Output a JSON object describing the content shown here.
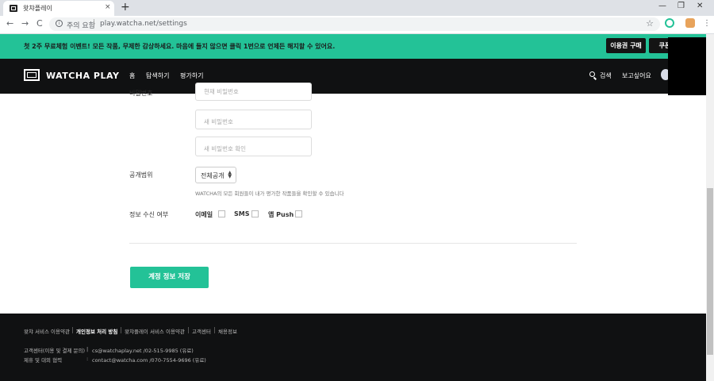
{
  "browser": {
    "tab_title": "왓챠플레이",
    "tab_close": "×",
    "new_tab": "+",
    "window_controls": [
      "—",
      "❐",
      "✕"
    ],
    "nav": {
      "back": "←",
      "forward": "→",
      "reload": "C"
    },
    "security_label": "주의 요함",
    "url": "play.watcha.net/settings",
    "star": "☆",
    "menu": "⋮"
  },
  "promo": {
    "text": "첫 2주 무료체험 이벤트! 모든 작품, 무제한 감상하세요. 마음에 들지 않으면 클릭 1번으로 언제든 해지할 수 있어요.",
    "buy_button": "이용권 구매",
    "coupon_button": "쿠폰"
  },
  "header": {
    "logo_text": "WATCHA PLAY",
    "nav": [
      "홈",
      "탐색하기",
      "평가하기"
    ],
    "search_label": "검색",
    "watchlist_label": "보고싶어요"
  },
  "form": {
    "password_label": "비밀번호",
    "current_password_placeholder": "현재 비밀번호",
    "new_password_placeholder": "새 비밀번호",
    "confirm_password_placeholder": "새 비밀번호 확인",
    "visibility_label": "공개범위",
    "visibility_value": "전체공개",
    "visibility_hint": "WATCHA의 모든 회원들이 내가 평가한 작품들을 확인할 수 있습니다",
    "subscription_label": "정보 수신 여부",
    "channels": [
      "이메일",
      "SMS",
      "앱 Push"
    ],
    "save_button": "계정 정보 저장"
  },
  "footer": {
    "links": [
      "왓챠 서비스 이용약관",
      "개인정보 처리 방침",
      "왓챠플레이 서비스 이용약관",
      "고객센터",
      "채용정보"
    ],
    "contact_rows": [
      {
        "label": "고객센터(이용 및 결제 문의)",
        "value": "cs@watchaplay.net /02-515-9985 (유료)"
      },
      {
        "label": "제휴 및 대외 협력",
        "value": "contact@watcha.com /070-7554-9696 (유료)"
      }
    ]
  }
}
